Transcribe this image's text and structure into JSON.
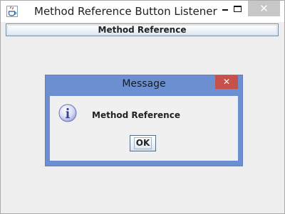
{
  "window": {
    "title": "Method Reference Button Listener",
    "icon": "java-cup-icon",
    "controls": {
      "minimize": "minimize-icon",
      "maximize": "maximize-icon",
      "close_label": "✕"
    }
  },
  "main": {
    "button_label": "Method Reference"
  },
  "dialog": {
    "title": "Message",
    "close_label": "✕",
    "icon": "info-icon",
    "message": "Method Reference",
    "ok_label": "OK",
    "colors": {
      "frame": "#6b8fd0",
      "close": "#c7504b"
    }
  }
}
